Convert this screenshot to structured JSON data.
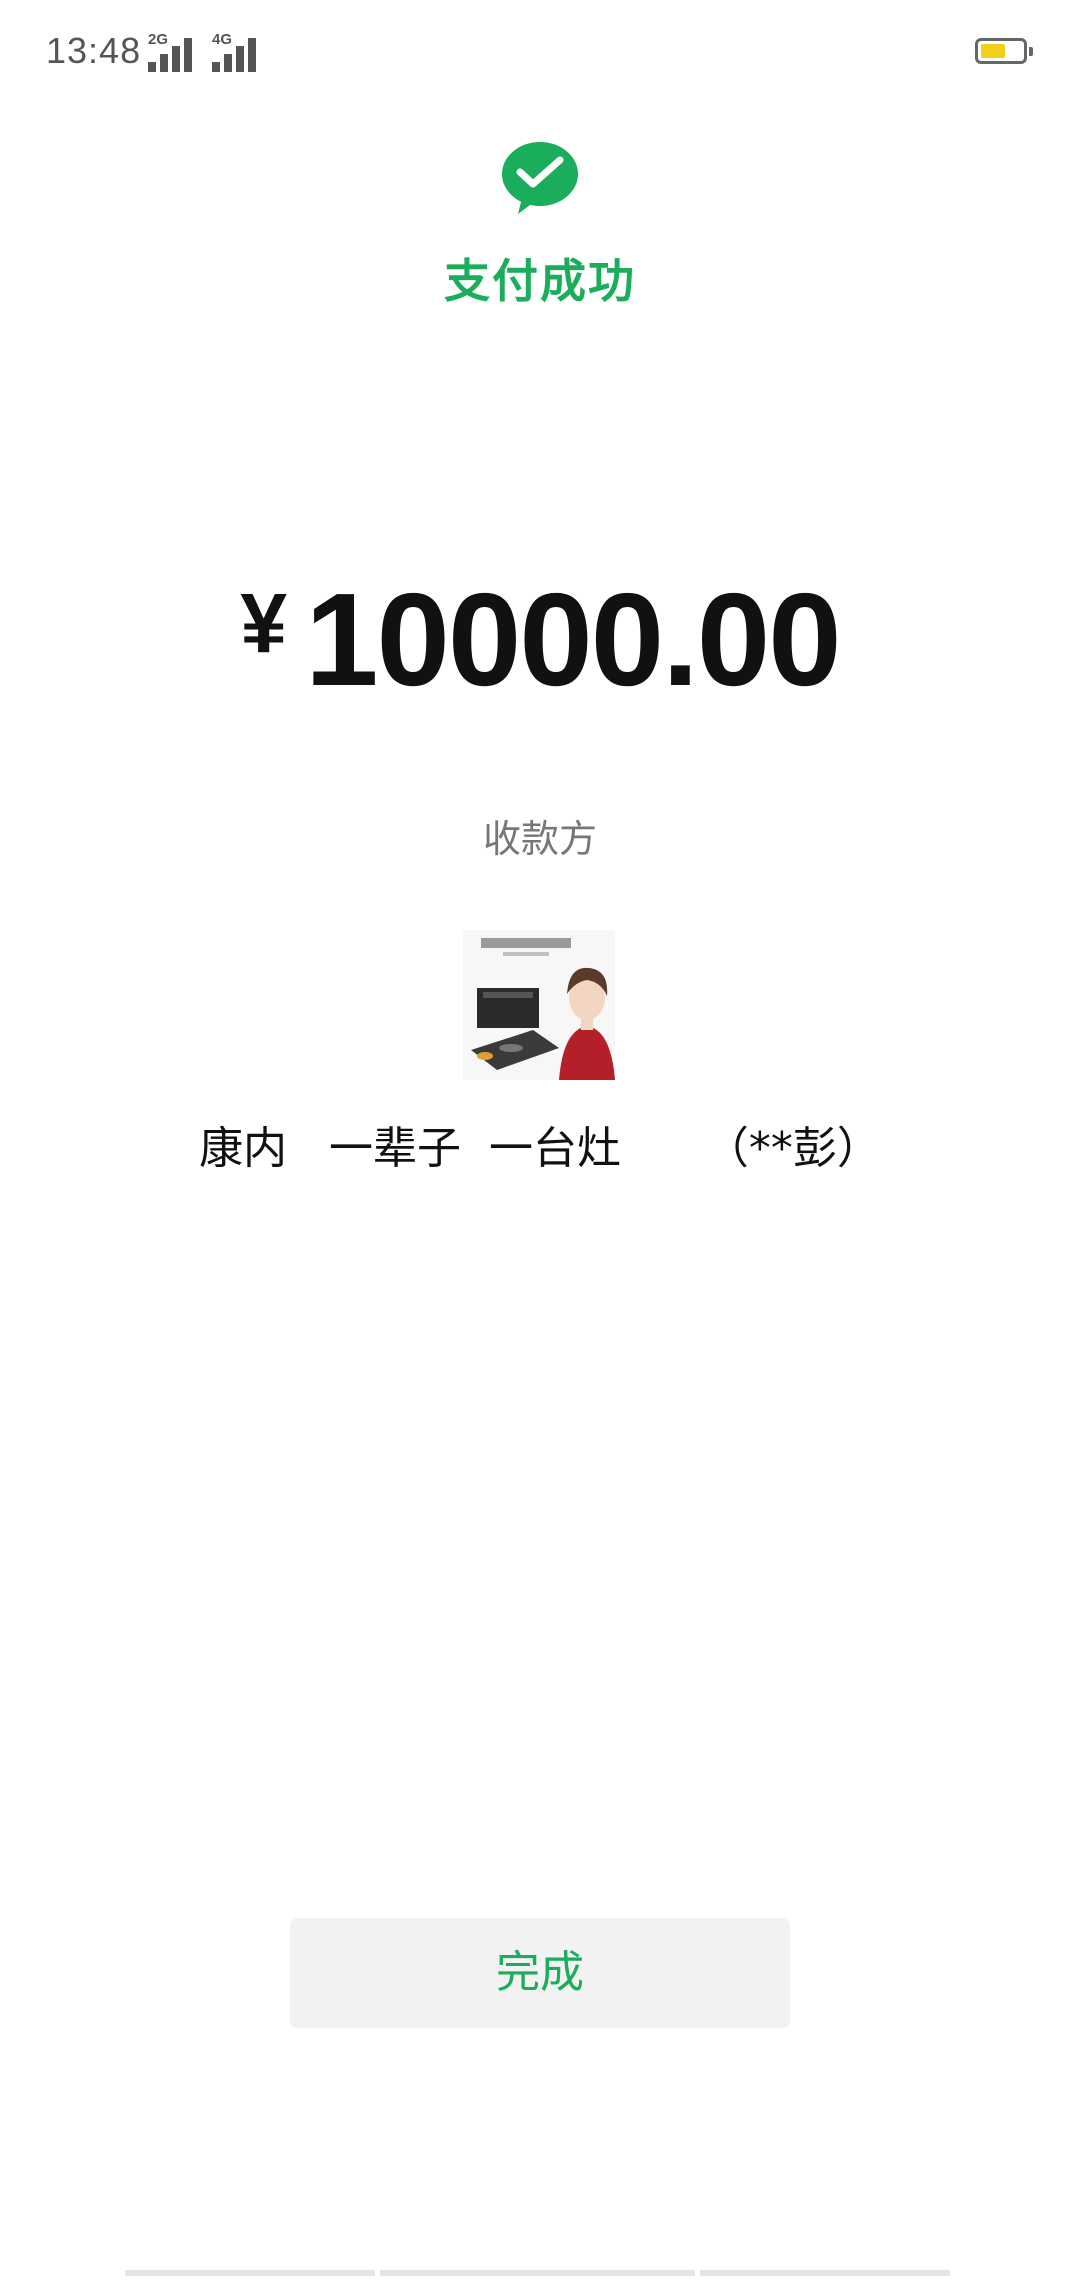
{
  "status_bar": {
    "time": "13:48",
    "signal_1_tag": "2G",
    "signal_2_tag": "4G",
    "battery_icon": "battery-icon",
    "battery_color": "#f2cf1b"
  },
  "header": {
    "logo_icon": "wechat-pay-check-icon",
    "title": "支付成功",
    "accent_color": "#1aad5b"
  },
  "payment": {
    "currency_symbol": "¥",
    "amount": "10000.00"
  },
  "payee": {
    "label": "收款方",
    "name": "康内   一辈子  一台灶      （**彭）"
  },
  "actions": {
    "done_label": "完成"
  }
}
